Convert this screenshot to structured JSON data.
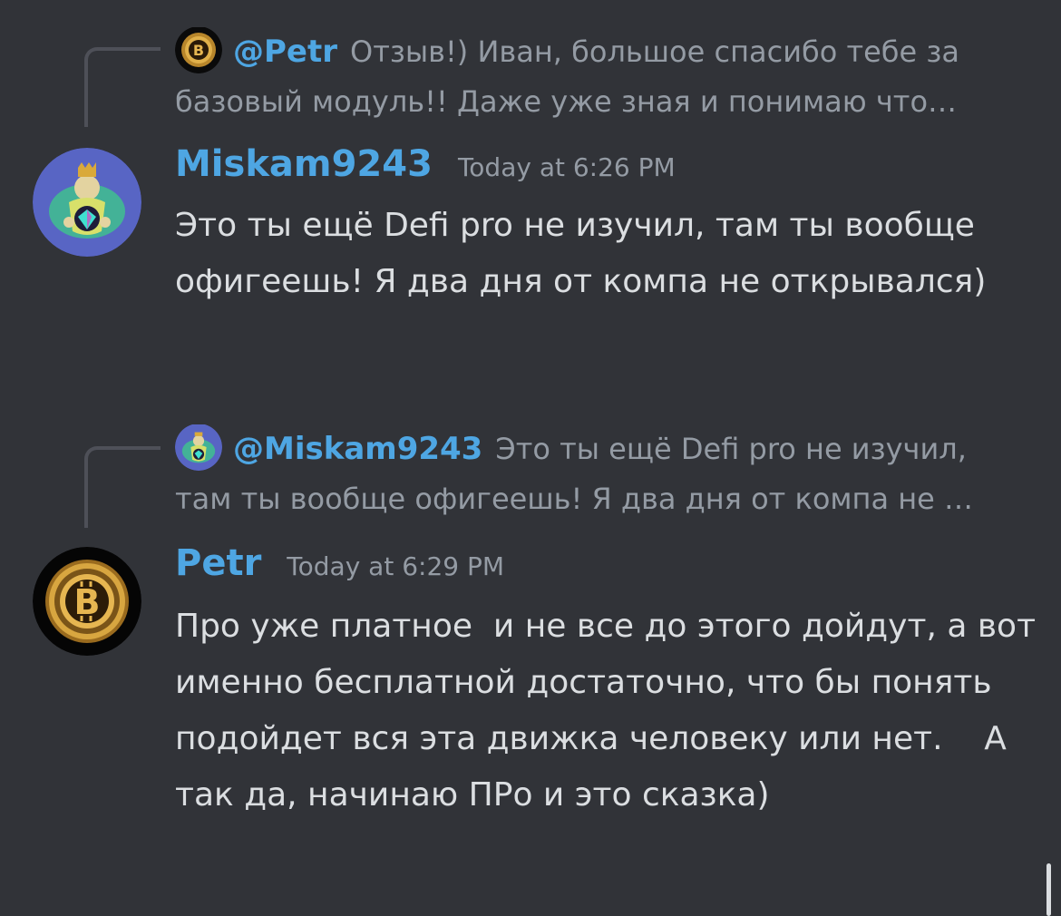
{
  "messages": [
    {
      "reply": {
        "mention": "@Petr",
        "text": "Отзыв!) Иван, большое спасибо тебе за базовый модуль!! Даже уже зная и понимаю что…",
        "avatar_icon": "bitcoin-avatar-icon"
      },
      "username": "Miskam9243",
      "timestamp": "Today at 6:26 PM",
      "avatar_icon": "king-diamond-avatar-icon",
      "content": "Это ты ещё Defi pro не изучил, там ты вообще офигеешь! Я два дня от компа не открывался)"
    },
    {
      "reply": {
        "mention": "@Miskam9243",
        "text": "Это ты ещё Defi pro не изучил, там ты вообще офигеешь! Я два дня от компа не …",
        "avatar_icon": "king-diamond-avatar-icon"
      },
      "username": "Petr",
      "timestamp": "Today at 6:29 PM",
      "avatar_icon": "bitcoin-avatar-icon",
      "content": "Про уже платное  и не все до этого дойдут, а вот именно бесплатной достаточно, что бы понять подойдет вся эта движка человеку или нет.    А так да, начинаю ПРо и это сказка)"
    }
  ],
  "colors": {
    "background": "#313338",
    "username": "#4ea6e3",
    "message_text": "#dbdee1",
    "muted_text": "#949ba4",
    "reply_spine": "#4e5058"
  }
}
